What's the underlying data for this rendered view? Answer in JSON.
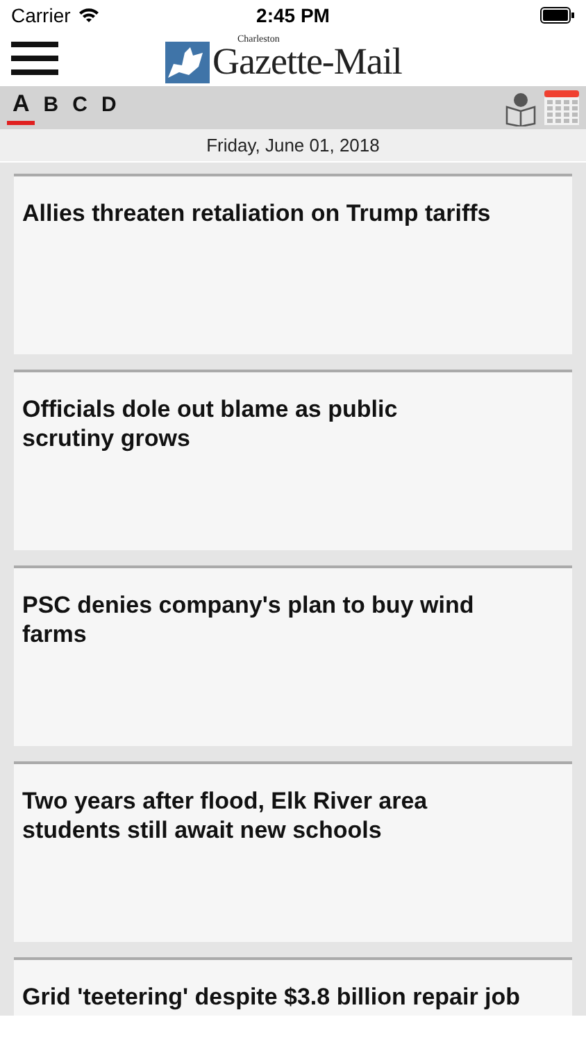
{
  "status_bar": {
    "carrier": "Carrier",
    "time": "2:45 PM"
  },
  "header": {
    "logo_small": "Charleston",
    "logo_name": "Gazette-Mail"
  },
  "sections": [
    {
      "label": "A",
      "selected": true
    },
    {
      "label": "B",
      "selected": false
    },
    {
      "label": "C",
      "selected": false
    },
    {
      "label": "D",
      "selected": false
    }
  ],
  "date": "Friday, June 01, 2018",
  "articles": [
    {
      "headline": "Allies threaten retaliation on Trump tariffs"
    },
    {
      "headline": "Officials dole out blame as public scrutiny grows"
    },
    {
      "headline": "PSC denies company's plan to buy wind farms"
    },
    {
      "headline": "Two years after flood, Elk River area students still await new schools"
    },
    {
      "headline": "Grid 'teetering' despite $3.8 billion repair job"
    }
  ]
}
